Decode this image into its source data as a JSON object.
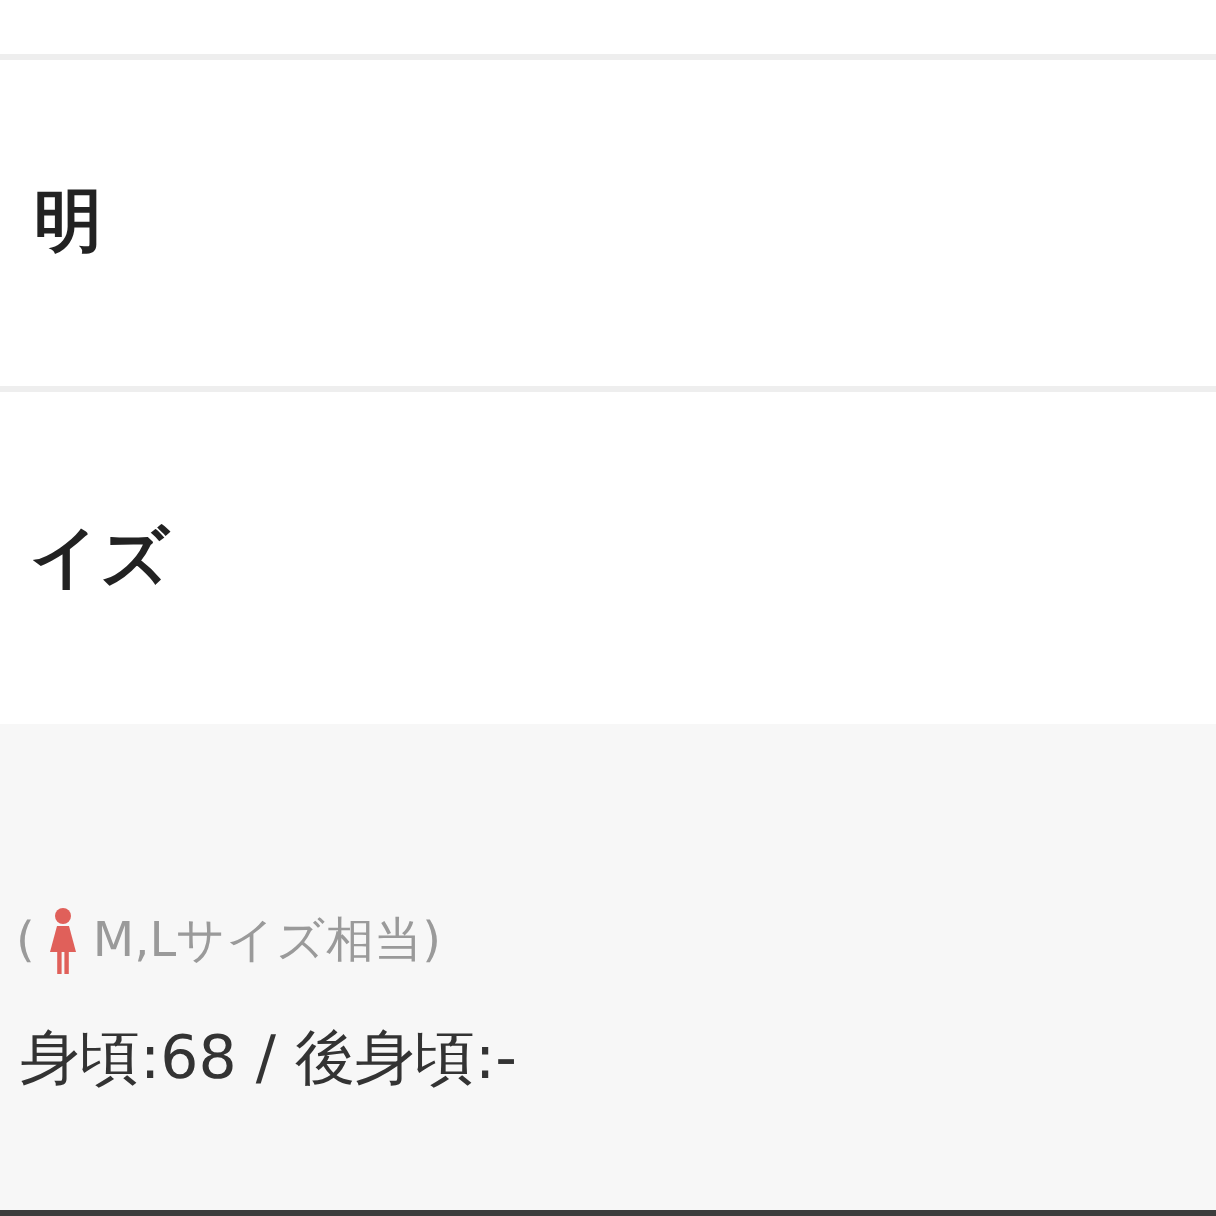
{
  "sections": [
    {
      "title": "明"
    },
    {
      "title": "イズ"
    }
  ],
  "size_info": {
    "note_before_icon": "(",
    "note_after_icon": "M,Lサイズ相当)",
    "measurements": "身頃:68 / 後身頃:-"
  }
}
